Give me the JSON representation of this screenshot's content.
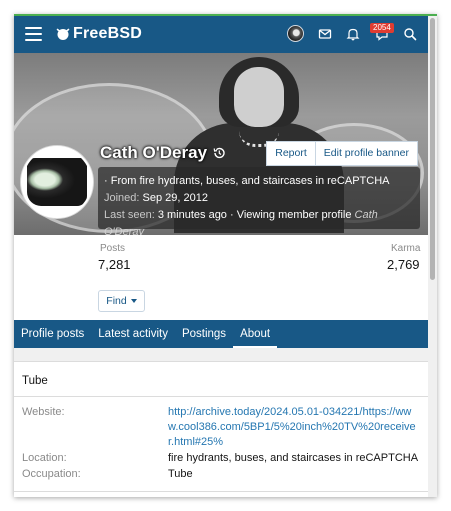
{
  "header": {
    "logo_text": "FreeBSD",
    "notification_count": "2054",
    "brand_color": "#185886",
    "icons": [
      "menu-icon",
      "freebsd-daemon-icon",
      "mail-icon",
      "bell-icon",
      "chat-icon",
      "search-icon"
    ]
  },
  "banner": {
    "report_label": "Report",
    "edit_banner_label": "Edit profile banner"
  },
  "profile": {
    "name": "Cath O'Deray",
    "tagline": "· From fire hydrants, buses, and staircases in reCAPTCHA",
    "joined_label": "Joined:",
    "joined_value": "Sep 29, 2012",
    "last_seen_label": "Last seen:",
    "last_seen_value": "3 minutes ago",
    "activity": "· Viewing member profile",
    "activity_target": "Cath O'Deray"
  },
  "stats": {
    "posts_label": "Posts",
    "posts_value": "7,281",
    "karma_label": "Karma",
    "karma_value": "2,769",
    "find_label": "Find"
  },
  "tabs": [
    {
      "label": "Profile posts"
    },
    {
      "label": "Latest activity"
    },
    {
      "label": "Postings"
    },
    {
      "label": "About",
      "active": true
    }
  ],
  "about": {
    "title": "Tube",
    "website_label": "Website:",
    "website_value": "http://archive.today/2024.05.01-034221/https://www.cool386.com/5BP1/5%20inch%20TV%20receiver.html#25%",
    "location_label": "Location:",
    "location_value": "fire hydrants, buses, and staircases in reCAPTCHA",
    "occupation_label": "Occupation:",
    "occupation_value": "Tube"
  }
}
